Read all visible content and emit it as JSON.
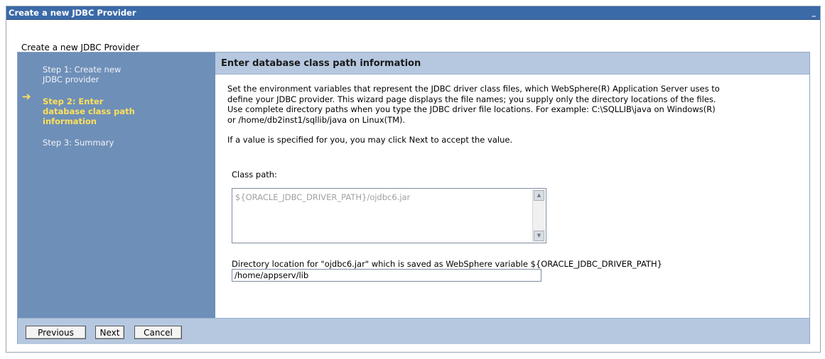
{
  "window": {
    "title": "Create a new JDBC Provider",
    "minimize_glyph": "_"
  },
  "page": {
    "heading": "Create a new JDBC Provider"
  },
  "steps": [
    {
      "line1": "Step 1: Create new",
      "line2": "JDBC provider",
      "active": false
    },
    {
      "line1": "Step 2: Enter",
      "line2": "database class path",
      "line3": "information",
      "active": true
    },
    {
      "line1": "Step 3: Summary",
      "active": false
    }
  ],
  "current_step_marker": "➔",
  "content": {
    "header": "Enter database class path information",
    "description": [
      "Set the environment variables that represent the JDBC driver class files, which WebSphere(R) Application Server uses to",
      "define your JDBC provider. This wizard page displays the file names; you supply only the directory locations of the files.",
      "Use complete directory paths when you type the JDBC driver file locations. For example: C:\\SQLLIB\\java on Windows(R)",
      "or /home/db2inst1/sqllib/java on Linux(TM)."
    ],
    "hint": "If a value is specified for you, you may click Next to accept the value.",
    "classpath_label": "Class path:",
    "classpath_value": "${ORACLE_JDBC_DRIVER_PATH}/ojdbc6.jar",
    "directory_label": "Directory location for \"ojdbc6.jar\" which is saved as WebSphere variable ${ORACLE_JDBC_DRIVER_PATH}",
    "directory_value": "/home/appserv/lib"
  },
  "buttons": {
    "previous": "Previous",
    "next": "Next",
    "cancel": "Cancel"
  },
  "icons": {
    "scroll_up": "scroll-up-icon",
    "scroll_down": "scroll-down-icon",
    "step_arrow": "arrow-right-icon",
    "minimize": "minimize-icon"
  },
  "colors": {
    "titlebar": "#3b6aa8",
    "steps_panel": "#6e8fb8",
    "active_step": "#ffe15a",
    "header_band": "#b5c8e0"
  }
}
